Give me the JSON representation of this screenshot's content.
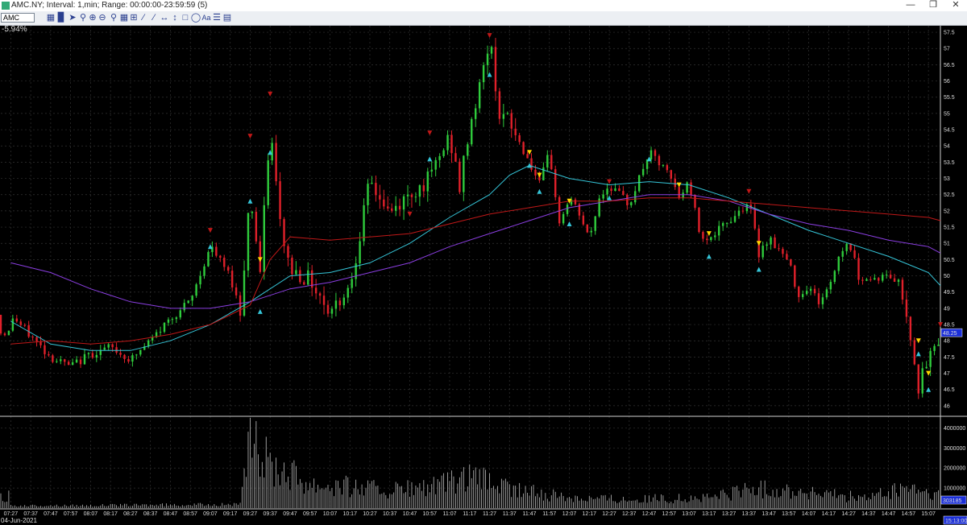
{
  "window": {
    "title": "AMC.NY; Interval: 1,min; Range: 00:00:00-23:59:59 (5)"
  },
  "toolbar": {
    "symbol": "AMC"
  },
  "chart": {
    "percent_change": "-5.94%",
    "date": "04-Jun-2021",
    "last_price_label": "48.25",
    "last_volume_label": "303185",
    "current_time_label": "15:13:00",
    "colors": {
      "up": "#2fcc3c",
      "down": "#e0202a",
      "cyan": "#35c5d8",
      "purple": "#8a3ee0",
      "red": "#c01818",
      "grid": "#333333",
      "marker_yellow": "#ffd400"
    }
  },
  "chart_data": [
    {
      "type": "candlestick",
      "title": "",
      "y_axis_ticks": [
        "46",
        "46.5",
        "47",
        "47.5",
        "48",
        "48.5",
        "49",
        "49.5",
        "50",
        "50.5",
        "51",
        "51.5",
        "52",
        "52.5",
        "53",
        "53.5",
        "54",
        "54.5",
        "55",
        "55.5",
        "56",
        "56.5",
        "57",
        "57.5"
      ],
      "ylim": [
        45.7,
        57.7
      ],
      "x_axis_ticks": [
        "07:27",
        "07:37",
        "07:47",
        "07:57",
        "08:07",
        "08:17",
        "08:27",
        "08:37",
        "08:47",
        "08:57",
        "09:07",
        "09:17",
        "09:27",
        "09:37",
        "09:47",
        "09:57",
        "10:07",
        "10:17",
        "10:27",
        "10:37",
        "10:47",
        "10:57",
        "11:07",
        "11:17",
        "11:27",
        "11:37",
        "11:47",
        "11:57",
        "12:07",
        "12:17",
        "12:27",
        "12:37",
        "12:47",
        "12:57",
        "13:07",
        "13:17",
        "13:27",
        "13:37",
        "13:47",
        "13:57",
        "14:07",
        "14:17",
        "14:27",
        "14:37",
        "14:47",
        "14:57",
        "15:07"
      ],
      "close_path": [
        [
          "07:27",
          48.8
        ],
        [
          "07:47",
          47.5
        ],
        [
          "07:57",
          47.2
        ],
        [
          "08:07",
          47.6
        ],
        [
          "08:17",
          47.8
        ],
        [
          "08:27",
          47.4
        ],
        [
          "08:37",
          48.0
        ],
        [
          "08:47",
          48.7
        ],
        [
          "08:57",
          49.2
        ],
        [
          "09:07",
          50.9
        ],
        [
          "09:17",
          50.0
        ],
        [
          "09:22",
          48.9
        ],
        [
          "09:27",
          52.6
        ],
        [
          "09:32",
          50.1
        ],
        [
          "09:37",
          54.6
        ],
        [
          "09:42",
          51.6
        ],
        [
          "09:47",
          50.2
        ],
        [
          "09:57",
          49.9
        ],
        [
          "10:07",
          48.9
        ],
        [
          "10:17",
          49.7
        ],
        [
          "10:22",
          51.3
        ],
        [
          "10:27",
          52.9
        ],
        [
          "10:37",
          51.9
        ],
        [
          "10:47",
          52.5
        ],
        [
          "10:57",
          53.0
        ],
        [
          "11:07",
          54.3
        ],
        [
          "11:12",
          52.7
        ],
        [
          "11:17",
          54.6
        ],
        [
          "11:22",
          55.8
        ],
        [
          "11:27",
          57.3
        ],
        [
          "11:32",
          55.0
        ],
        [
          "11:37",
          54.7
        ],
        [
          "11:47",
          53.5
        ],
        [
          "11:52",
          52.8
        ],
        [
          "11:57",
          53.8
        ],
        [
          "12:02",
          51.6
        ],
        [
          "12:07",
          52.4
        ],
        [
          "12:12",
          51.9
        ],
        [
          "12:17",
          51.1
        ],
        [
          "12:22",
          52.4
        ],
        [
          "12:27",
          52.8
        ],
        [
          "12:37",
          52.2
        ],
        [
          "12:47",
          53.8
        ],
        [
          "12:57",
          53.1
        ],
        [
          "13:02",
          52.4
        ],
        [
          "13:07",
          52.9
        ],
        [
          "13:12",
          51.4
        ],
        [
          "13:17",
          51.1
        ],
        [
          "13:27",
          51.7
        ],
        [
          "13:37",
          52.3
        ],
        [
          "13:42",
          50.7
        ],
        [
          "13:47",
          51.2
        ],
        [
          "13:57",
          50.4
        ],
        [
          "14:02",
          49.4
        ],
        [
          "14:07",
          49.7
        ],
        [
          "14:12",
          49.2
        ],
        [
          "14:17",
          49.6
        ],
        [
          "14:22",
          50.6
        ],
        [
          "14:27",
          51.1
        ],
        [
          "14:32",
          50.0
        ],
        [
          "14:37",
          49.9
        ],
        [
          "14:47",
          50.0
        ],
        [
          "14:52",
          49.8
        ],
        [
          "14:57",
          48.6
        ],
        [
          "15:02",
          46.6
        ],
        [
          "15:07",
          47.4
        ],
        [
          "15:13",
          48.25
        ]
      ],
      "overlays": [
        {
          "color": "cyan",
          "points": [
            [
              "07:27",
              48.6
            ],
            [
              "07:47",
              47.9
            ],
            [
              "08:07",
              47.7
            ],
            [
              "08:27",
              47.7
            ],
            [
              "08:47",
              48.0
            ],
            [
              "09:07",
              48.5
            ],
            [
              "09:27",
              49.2
            ],
            [
              "09:47",
              50.0
            ],
            [
              "10:07",
              50.1
            ],
            [
              "10:27",
              50.4
            ],
            [
              "10:47",
              51.0
            ],
            [
              "11:07",
              51.8
            ],
            [
              "11:27",
              52.5
            ],
            [
              "11:37",
              53.1
            ],
            [
              "11:47",
              53.4
            ],
            [
              "12:07",
              53.0
            ],
            [
              "12:27",
              52.8
            ],
            [
              "12:47",
              52.9
            ],
            [
              "13:07",
              52.8
            ],
            [
              "13:27",
              52.4
            ],
            [
              "13:47",
              51.9
            ],
            [
              "14:07",
              51.4
            ],
            [
              "14:27",
              51.0
            ],
            [
              "14:47",
              50.6
            ],
            [
              "15:07",
              50.1
            ],
            [
              "15:13",
              49.7
            ]
          ]
        },
        {
          "color": "purple",
          "points": [
            [
              "07:27",
              50.4
            ],
            [
              "07:47",
              50.1
            ],
            [
              "08:07",
              49.6
            ],
            [
              "08:27",
              49.2
            ],
            [
              "08:47",
              49.0
            ],
            [
              "09:07",
              49.0
            ],
            [
              "09:27",
              49.2
            ],
            [
              "09:47",
              49.6
            ],
            [
              "10:07",
              49.8
            ],
            [
              "10:27",
              50.1
            ],
            [
              "10:47",
              50.4
            ],
            [
              "11:07",
              50.9
            ],
            [
              "11:27",
              51.3
            ],
            [
              "11:47",
              51.7
            ],
            [
              "12:07",
              52.1
            ],
            [
              "12:27",
              52.3
            ],
            [
              "12:47",
              52.5
            ],
            [
              "13:07",
              52.5
            ],
            [
              "13:27",
              52.3
            ],
            [
              "13:47",
              51.9
            ],
            [
              "14:07",
              51.6
            ],
            [
              "14:27",
              51.4
            ],
            [
              "14:47",
              51.1
            ],
            [
              "15:07",
              50.9
            ],
            [
              "15:13",
              50.7
            ]
          ]
        },
        {
          "color": "red",
          "points": [
            [
              "07:27",
              47.9
            ],
            [
              "07:47",
              48.0
            ],
            [
              "08:07",
              47.9
            ],
            [
              "08:27",
              48.0
            ],
            [
              "08:47",
              48.2
            ],
            [
              "09:07",
              48.5
            ],
            [
              "09:27",
              49.1
            ],
            [
              "09:37",
              50.5
            ],
            [
              "09:47",
              51.2
            ],
            [
              "10:07",
              51.1
            ],
            [
              "10:27",
              51.2
            ],
            [
              "10:47",
              51.3
            ],
            [
              "11:07",
              51.6
            ],
            [
              "11:27",
              51.9
            ],
            [
              "11:47",
              52.1
            ],
            [
              "12:07",
              52.3
            ],
            [
              "12:27",
              52.3
            ],
            [
              "12:47",
              52.4
            ],
            [
              "13:07",
              52.4
            ],
            [
              "13:27",
              52.3
            ],
            [
              "13:47",
              52.2
            ],
            [
              "14:07",
              52.1
            ],
            [
              "14:27",
              52.0
            ],
            [
              "14:47",
              51.9
            ],
            [
              "15:07",
              51.8
            ],
            [
              "15:13",
              51.7
            ]
          ]
        }
      ],
      "markers": [
        {
          "time": "09:07",
          "price": 51.4,
          "kind": "down",
          "color": "red"
        },
        {
          "time": "09:07",
          "price": 50.9,
          "kind": "up",
          "color": "cyan"
        },
        {
          "time": "09:27",
          "price": 54.3,
          "kind": "down",
          "color": "red"
        },
        {
          "time": "09:27",
          "price": 52.3,
          "kind": "up",
          "color": "cyan"
        },
        {
          "time": "09:32",
          "price": 50.5,
          "kind": "down",
          "color": "yellow"
        },
        {
          "time": "09:32",
          "price": 48.9,
          "kind": "up",
          "color": "cyan"
        },
        {
          "time": "09:37",
          "price": 55.6,
          "kind": "down",
          "color": "red"
        },
        {
          "time": "09:37",
          "price": 53.8,
          "kind": "up",
          "color": "cyan"
        },
        {
          "time": "10:47",
          "price": 51.9,
          "kind": "down",
          "color": "red"
        },
        {
          "time": "10:57",
          "price": 54.4,
          "kind": "down",
          "color": "red"
        },
        {
          "time": "10:57",
          "price": 53.6,
          "kind": "up",
          "color": "cyan"
        },
        {
          "time": "11:27",
          "price": 57.4,
          "kind": "down",
          "color": "red"
        },
        {
          "time": "11:27",
          "price": 56.2,
          "kind": "up",
          "color": "cyan"
        },
        {
          "time": "11:47",
          "price": 53.8,
          "kind": "down",
          "color": "yellow"
        },
        {
          "time": "11:47",
          "price": 53.4,
          "kind": "up",
          "color": "cyan"
        },
        {
          "time": "11:52",
          "price": 53.1,
          "kind": "down",
          "color": "yellow"
        },
        {
          "time": "11:52",
          "price": 52.6,
          "kind": "up",
          "color": "cyan"
        },
        {
          "time": "12:07",
          "price": 52.3,
          "kind": "down",
          "color": "yellow"
        },
        {
          "time": "12:07",
          "price": 51.6,
          "kind": "up",
          "color": "cyan"
        },
        {
          "time": "12:27",
          "price": 52.9,
          "kind": "down",
          "color": "red"
        },
        {
          "time": "12:27",
          "price": 52.4,
          "kind": "up",
          "color": "cyan"
        },
        {
          "time": "12:47",
          "price": 53.6,
          "kind": "up",
          "color": "cyan"
        },
        {
          "time": "13:02",
          "price": 52.8,
          "kind": "down",
          "color": "yellow"
        },
        {
          "time": "13:17",
          "price": 51.3,
          "kind": "down",
          "color": "yellow"
        },
        {
          "time": "13:17",
          "price": 50.6,
          "kind": "up",
          "color": "cyan"
        },
        {
          "time": "13:37",
          "price": 52.6,
          "kind": "down",
          "color": "red"
        },
        {
          "time": "13:42",
          "price": 51.0,
          "kind": "down",
          "color": "yellow"
        },
        {
          "time": "13:42",
          "price": 50.2,
          "kind": "up",
          "color": "cyan"
        },
        {
          "time": "15:02",
          "price": 48.0,
          "kind": "down",
          "color": "yellow"
        },
        {
          "time": "15:02",
          "price": 47.6,
          "kind": "up",
          "color": "cyan"
        },
        {
          "time": "15:07",
          "price": 47.0,
          "kind": "down",
          "color": "yellow"
        },
        {
          "time": "15:07",
          "price": 46.5,
          "kind": "up",
          "color": "cyan"
        },
        {
          "time": "15:13",
          "price": 48.5,
          "kind": "down",
          "color": "red"
        }
      ]
    },
    {
      "type": "bar",
      "title": "",
      "y_axis_ticks": [
        "1000000",
        "2000000",
        "3000000",
        "4000000"
      ],
      "ylim": [
        0,
        4500000
      ],
      "volume_profile": [
        [
          "07:27",
          150000
        ],
        [
          "09:22",
          250000
        ],
        [
          "09:27",
          4400000
        ],
        [
          "09:37",
          3100000
        ],
        [
          "09:47",
          2500000
        ],
        [
          "09:57",
          1700000
        ],
        [
          "10:17",
          1500000
        ],
        [
          "10:37",
          1200000
        ],
        [
          "10:57",
          1400000
        ],
        [
          "11:17",
          2000000
        ],
        [
          "11:27",
          1800000
        ],
        [
          "11:37",
          1300000
        ],
        [
          "11:57",
          900000
        ],
        [
          "12:17",
          700000
        ],
        [
          "12:37",
          600000
        ],
        [
          "12:57",
          650000
        ],
        [
          "13:17",
          700000
        ],
        [
          "13:37",
          1300000
        ],
        [
          "13:57",
          1200000
        ],
        [
          "14:17",
          900000
        ],
        [
          "14:37",
          700000
        ],
        [
          "14:57",
          1400000
        ],
        [
          "15:07",
          1000000
        ],
        [
          "15:13",
          800000
        ]
      ]
    }
  ]
}
